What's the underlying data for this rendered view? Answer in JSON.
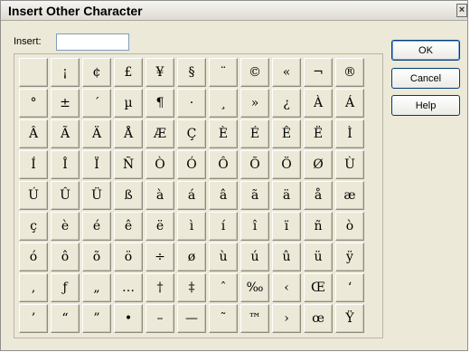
{
  "window": {
    "title": "Insert Other Character",
    "close_glyph": "×"
  },
  "insert": {
    "label": "Insert:",
    "value": ""
  },
  "buttons": {
    "ok": "OK",
    "cancel": "Cancel",
    "help": "Help"
  },
  "characters": [
    " ",
    "¡",
    "¢",
    "£",
    "¥",
    "§",
    "¨",
    "©",
    "«",
    "¬",
    "®",
    "°",
    "±",
    "´",
    "µ",
    "¶",
    "·",
    "¸",
    "»",
    "¿",
    "À",
    "Á",
    "Â",
    "Ã",
    "Ä",
    "Å",
    "Æ",
    "Ç",
    "È",
    "É",
    "Ê",
    "Ë",
    "Ì",
    "Í",
    "Î",
    "Ï",
    "Ñ",
    "Ò",
    "Ó",
    "Ô",
    "Õ",
    "Ö",
    "Ø",
    "Ù",
    "Ú",
    "Û",
    "Ü",
    "ß",
    "à",
    "á",
    "â",
    "ã",
    "ä",
    "å",
    "æ",
    "ç",
    "è",
    "é",
    "ê",
    "ë",
    "ì",
    "í",
    "î",
    "ï",
    "ñ",
    "ò",
    "ó",
    "ô",
    "õ",
    "ö",
    "÷",
    "ø",
    "ù",
    "ú",
    "û",
    "ü",
    "ÿ",
    "‚",
    "ƒ",
    "„",
    "…",
    "†",
    "‡",
    "ˆ",
    "‰",
    "‹",
    "Œ",
    "‘",
    "’",
    "“",
    "”",
    "•",
    "–",
    "—",
    "˜",
    "™",
    "›",
    "œ",
    "Ÿ"
  ]
}
